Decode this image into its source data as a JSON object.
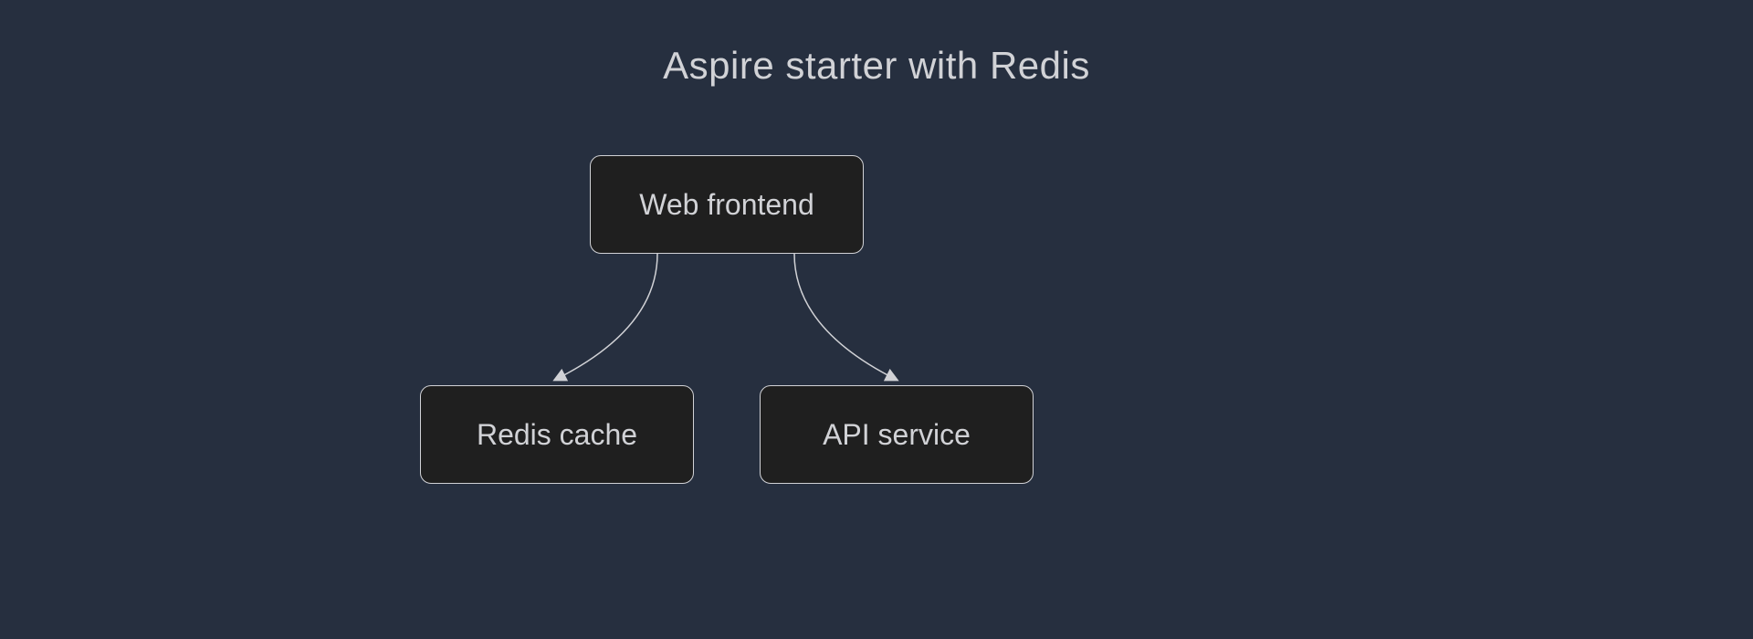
{
  "title": "Aspire starter with Redis",
  "nodes": {
    "top": {
      "label": "Web frontend"
    },
    "bottomLeft": {
      "label": "Redis cache"
    },
    "bottomRight": {
      "label": "API service"
    }
  },
  "diagram": {
    "type": "tree",
    "root": "Web frontend",
    "children": [
      "Redis cache",
      "API service"
    ],
    "edges": [
      {
        "from": "Web frontend",
        "to": "Redis cache",
        "directed": true
      },
      {
        "from": "Web frontend",
        "to": "API service",
        "directed": true
      }
    ]
  },
  "colors": {
    "background": "#262f3f",
    "nodeBackground": "#1f1f1f",
    "nodeBorder": "#d1d2d6",
    "text": "#d1d2d6",
    "connector": "#d1d2d6"
  }
}
